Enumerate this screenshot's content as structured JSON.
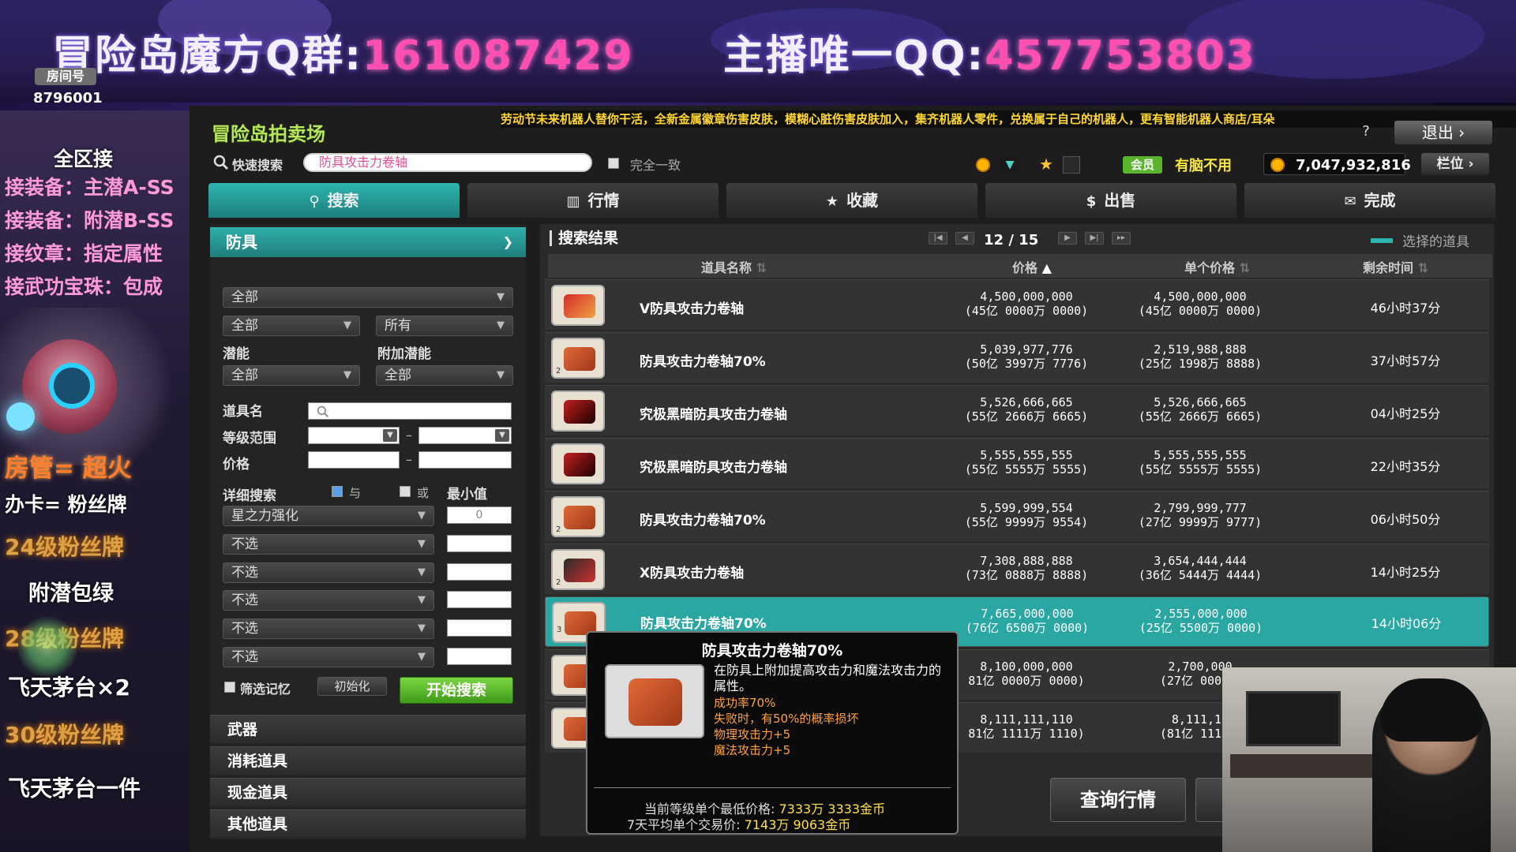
{
  "banner": {
    "qq_group_label": "冒险岛魔方Q群:",
    "qq_group_number": "161087429",
    "host_qq_label": "主播唯一QQ:",
    "host_qq_number": "457753803",
    "room_badge": "房间号",
    "room_id": "8796001"
  },
  "overlay_left": {
    "lines": [
      "全区接",
      "接装备：主潜A-SS",
      "接装备：附潜B-SS",
      "接纹章：指定属性",
      "接武功宝珠：包成",
      "房管=  超火",
      "办卡=  粉丝牌",
      "24级粉丝牌",
      "附潜包绿",
      "28级粉丝牌",
      "飞天茅台×2",
      "30级粉丝牌",
      "飞天茅台一件"
    ]
  },
  "game": {
    "title": "冒险岛拍卖场",
    "marquee": "劳动节未来机器人替你干活，全新金属徽章伤害皮肤，模糊心脏伤害皮肤加入，集齐机器人零件，兑换属于自己的机器人，更有智能机器人商店/耳朵",
    "help_label": "?",
    "logout_label": "退出 ›",
    "quick_search_label": "快速搜索",
    "quick_search_value": "防具攻击力卷轴",
    "exact_match_label": "完全一致",
    "vip_badge": "会员",
    "vip_status": "有脑不用",
    "meso": "7,047,932,816",
    "slot_label": "栏位 ›",
    "tabs": [
      "搜索",
      "行情",
      "收藏",
      "出售",
      "完成"
    ]
  },
  "filters": {
    "category": "防具",
    "type_all": "全部",
    "sub1": "全部",
    "sub2": "所有",
    "potential_label": "潜能",
    "bonus_potential_label": "附加潜能",
    "potential_value": "全部",
    "bonus_potential_value": "全部",
    "item_name_label": "道具名",
    "level_range_label": "等级范围",
    "price_label": "价格",
    "detail_search_label": "详细搜索",
    "and_label": "与",
    "or_label": "或",
    "min_label": "最小值",
    "stat_rows": [
      {
        "name": "星之力强化",
        "min": "0"
      },
      {
        "name": "不选",
        "min": ""
      },
      {
        "name": "不选",
        "min": ""
      },
      {
        "name": "不选",
        "min": ""
      },
      {
        "name": "不选",
        "min": ""
      },
      {
        "name": "不选",
        "min": ""
      }
    ],
    "remember_label": "筛选记忆",
    "reset_label": "初始化",
    "search_button": "开始搜索",
    "other_categories": [
      "武器",
      "消耗道具",
      "现金道具",
      "其他道具"
    ]
  },
  "results": {
    "title": "搜索结果",
    "current_page": "12",
    "total_pages": "15",
    "legend_label": "选择的道具",
    "columns": [
      "道具名称",
      "价格",
      "单个价格",
      "剩余时间"
    ],
    "rows": [
      {
        "qty": "",
        "name": "V防具攻击力卷轴",
        "price": "4,500,000,000",
        "price_cn": "(45亿 0000万 0000)",
        "unit": "4,500,000,000",
        "unit_cn": "(45亿 0000万 0000)",
        "time": "46小时37分",
        "style": "v"
      },
      {
        "qty": "2",
        "name": "防具攻击力卷轴70%",
        "price": "5,039,977,776",
        "price_cn": "(50亿 3997万 7776)",
        "unit": "2,519,988,888",
        "unit_cn": "(25亿 1998万 8888)",
        "time": "37小时57分",
        "style": "n"
      },
      {
        "qty": "",
        "name": "究极黑暗防具攻击力卷轴",
        "price": "5,526,666,665",
        "price_cn": "(55亿 2666万 6665)",
        "unit": "5,526,666,665",
        "unit_cn": "(55亿 2666万 6665)",
        "time": "04小时25分",
        "style": "d"
      },
      {
        "qty": "",
        "name": "究极黑暗防具攻击力卷轴",
        "price": "5,555,555,555",
        "price_cn": "(55亿 5555万 5555)",
        "unit": "5,555,555,555",
        "unit_cn": "(55亿 5555万 5555)",
        "time": "22小时35分",
        "style": "d"
      },
      {
        "qty": "2",
        "name": "防具攻击力卷轴70%",
        "price": "5,599,999,554",
        "price_cn": "(55亿 9999万 9554)",
        "unit": "2,799,999,777",
        "unit_cn": "(27亿 9999万 9777)",
        "time": "06小时50分",
        "style": "n"
      },
      {
        "qty": "2",
        "name": "X防具攻击力卷轴",
        "price": "7,308,888,888",
        "price_cn": "(73亿 0888万 8888)",
        "unit": "3,654,444,444",
        "unit_cn": "(36亿 5444万 4444)",
        "time": "14小时25分",
        "style": "x"
      },
      {
        "qty": "3",
        "name": "防具攻击力卷轴70%",
        "price": "7,665,000,000",
        "price_cn": "(76亿 6500万 0000)",
        "unit": "2,555,000,000",
        "unit_cn": "(25亿 5500万 0000)",
        "time": "14小时06分",
        "style": "n",
        "selected": true
      },
      {
        "qty": "",
        "name": "",
        "price": "8,100,000,000",
        "price_cn": "81亿 0000万 0000)",
        "unit": "2,700,000",
        "unit_cn": "(27亿 0000万",
        "time": "",
        "style": "n"
      },
      {
        "qty": "",
        "name": "",
        "price": "8,111,111,110",
        "price_cn": "81亿 1111万 1110)",
        "unit": "8,111,11",
        "unit_cn": "(81亿 1111万",
        "time": "",
        "style": "n"
      }
    ],
    "query_button": "查询行情"
  },
  "tooltip": {
    "title": "防具攻击力卷轴70%",
    "description": "在防具上附加提高攻击力和魔法攻击力的属性。",
    "success_rate": "成功率70%",
    "fail": "失败时，有50%的概率损坏",
    "stat1": "物理攻击力+5",
    "stat2": "魔法攻击力+5",
    "lowest_label": "当前等级单个最低价格:",
    "lowest_value": "7333万 3333金币",
    "avg_label": "7天平均单个交易价:",
    "avg_value": "7143万 9063金币"
  }
}
